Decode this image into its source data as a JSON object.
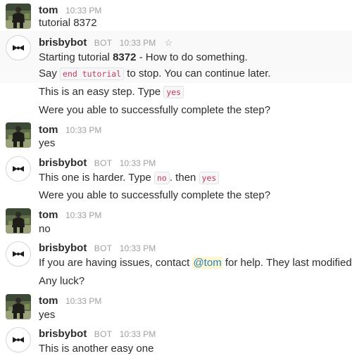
{
  "messages": [
    {
      "author": "tom",
      "time": "10:33 PM",
      "lines": [
        "tutorial 8372"
      ]
    },
    {
      "author": "brisbybot",
      "tag": "BOT",
      "time": "10:33 PM",
      "l1_pre": "Starting tutorial ",
      "l1_num": "8372",
      "l1_post": " - How to do something.",
      "l2_pre": "Say ",
      "l2_code": "end tutorial",
      "l2_post": " to stop. You can continue later.",
      "l3_pre": "This is an easy step. Type ",
      "l3_code": "yes",
      "l4": "Were you able to successfully complete the step?"
    },
    {
      "author": "tom",
      "time": "10:33 PM",
      "line": "yes"
    },
    {
      "author": "brisbybot",
      "tag": "BOT",
      "time": "10:33 PM",
      "l1_pre": "This one is harder. Type ",
      "l1_code1": "no",
      ". then": "",
      "l1_mid": ". then ",
      "l1_code2": "yes",
      "l2": "Were you able to successfully complete the step?"
    },
    {
      "author": "tom",
      "time": "10:33 PM",
      "line": "no"
    },
    {
      "author": "brisbybot",
      "tag": "BOT",
      "time": "10:33 PM",
      "l1_pre": "If you are having issues, contact ",
      "l1_mention": "@tom",
      "l1_post": " for help. They last modified thi",
      "l2": "Any luck?"
    },
    {
      "author": "tom",
      "time": "10:33 PM",
      "line": "yes"
    },
    {
      "author": "brisbybot",
      "tag": "BOT",
      "time": "10:33 PM",
      "l1": "This is another easy one"
    }
  ]
}
